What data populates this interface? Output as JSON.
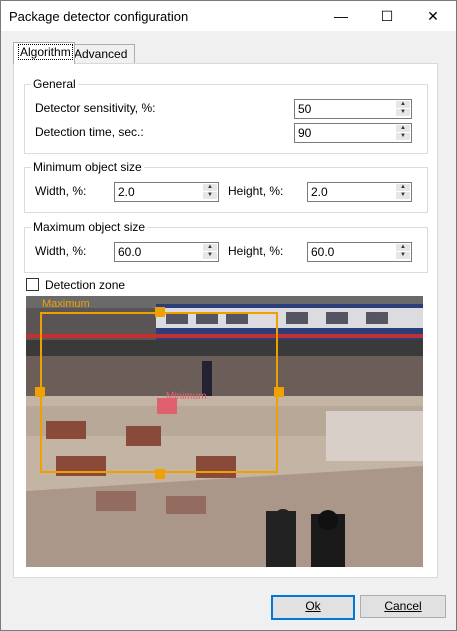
{
  "window": {
    "title": "Package detector configuration",
    "minimize_glyph": "—",
    "maximize_glyph": "☐",
    "close_glyph": "✕"
  },
  "tabs": [
    {
      "label": "Algorithm",
      "active": true
    },
    {
      "label": "Advanced",
      "active": false
    }
  ],
  "general": {
    "legend": "General",
    "sensitivity_label": "Detector sensitivity, %:",
    "sensitivity_value": "50",
    "time_label": "Detection time, sec.:",
    "time_value": "90"
  },
  "min_size": {
    "legend": "Minimum object size",
    "width_label": "Width, %:",
    "width_value": "2.0",
    "height_label": "Height, %:",
    "height_value": "2.0"
  },
  "max_size": {
    "legend": "Maximum object size",
    "width_label": "Width, %:",
    "width_value": "60.0",
    "height_label": "Height, %:",
    "height_value": "60.0"
  },
  "detection_zone": {
    "label": "Detection zone",
    "checked": false
  },
  "preview": {
    "max_label": "Maximum",
    "min_label": "Minimum",
    "box_color": "#f0a000",
    "min_color": "#e06070"
  },
  "buttons": {
    "ok": "Ok",
    "cancel": "Cancel"
  }
}
